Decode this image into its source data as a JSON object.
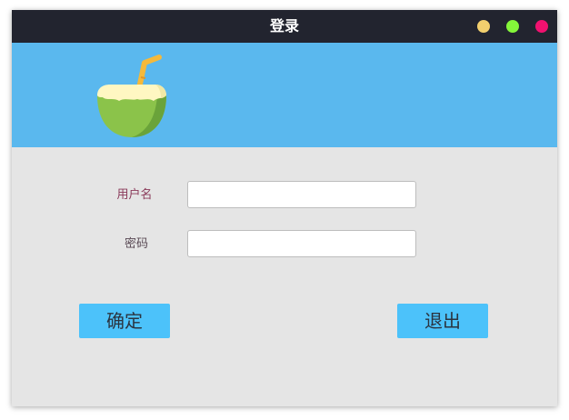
{
  "window": {
    "title": "登录",
    "controls": {
      "minimize_color": "#f2cf6e",
      "maximize_color": "#84f53a",
      "close_color": "#f0116f"
    }
  },
  "banner": {
    "background": "#5ab8ee",
    "logo_icon": "coconut-icon"
  },
  "form": {
    "username_label": "用户名",
    "username_value": "",
    "password_label": "密码",
    "password_value": ""
  },
  "buttons": {
    "confirm_label": "确定",
    "exit_label": "退出",
    "color": "#4cc2fa"
  }
}
